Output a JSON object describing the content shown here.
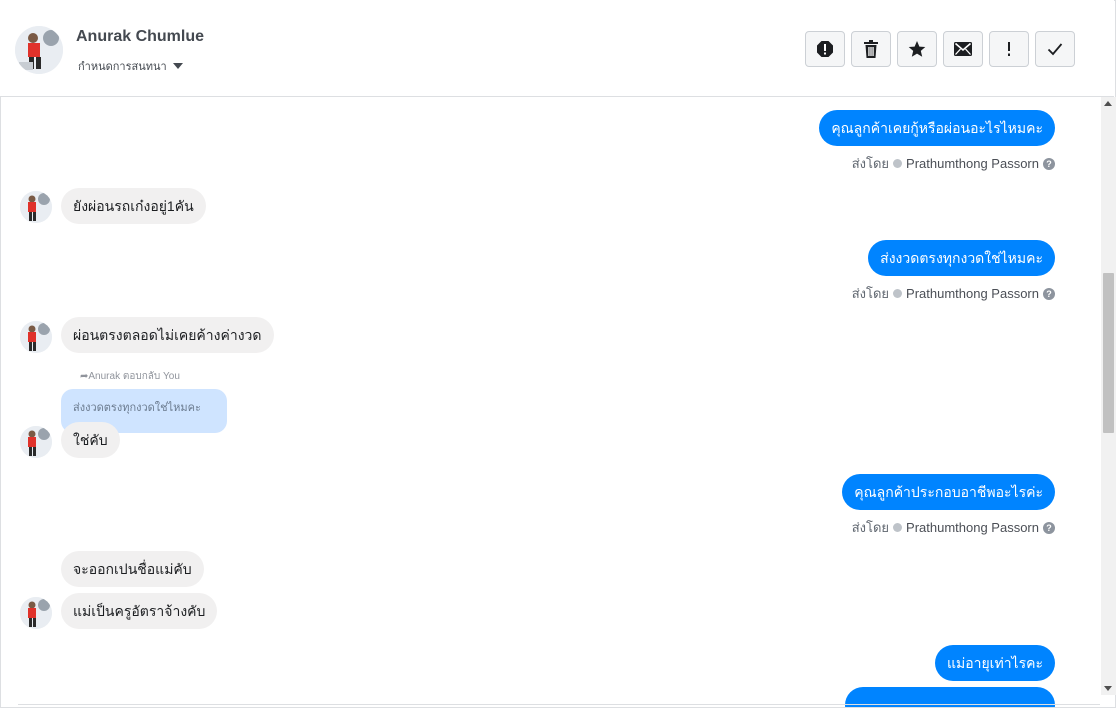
{
  "header": {
    "contact_name": "Anurak Chumlue",
    "assign_label": "กำหนดการสนทนา",
    "actions": [
      {
        "name": "report-icon"
      },
      {
        "name": "trash-icon"
      },
      {
        "name": "star-icon"
      },
      {
        "name": "envelope-icon"
      },
      {
        "name": "exclamation-icon"
      },
      {
        "name": "check-icon"
      }
    ]
  },
  "messages": {
    "out1": "คุณลูกค้าเคยกู้หรือผ่อนอะไรไหมคะ",
    "out2": "ส่งงวดตรงทุกงวดใช่ไหมคะ",
    "out3": "คุณลูกค้าประกอบอาชีพอะไรค่ะ",
    "out4": "แม่อายุเท่าไรคะ",
    "in1": "ยังผ่อนรถเก๋งอยู่1คัน",
    "in2": "ผ่อนตรงตลอดไม่เคยค้างค่างวด",
    "in3": "ใช่คับ",
    "in4": "จะออกเปนชื่อแม่คับ",
    "in5": "แม่เป็นครูอัตราจ้างคับ"
  },
  "reply": {
    "meta": "Anurak ตอบกลับ You",
    "quote": "ส่งงวดตรงทุกงวดใช่ไหมคะ"
  },
  "sent_by": {
    "prefix": "ส่งโดย",
    "agent": "Prathumthong Passorn"
  },
  "colors": {
    "outgoing_bubble": "#0084ff",
    "incoming_bubble": "#f1f0f0",
    "reply_quote_bg": "#cfe4ff"
  }
}
